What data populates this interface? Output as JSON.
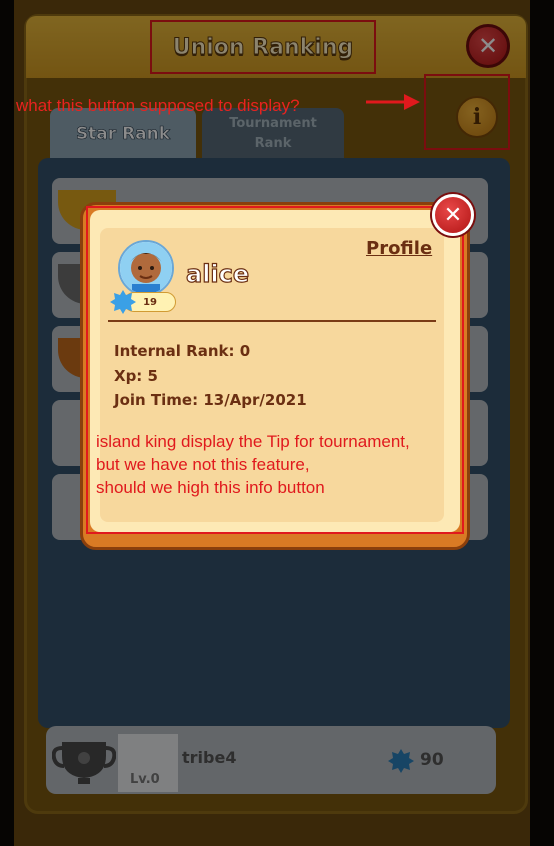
{
  "header": {
    "title": "Union Ranking",
    "close_icon": "close-icon"
  },
  "tabs": [
    {
      "label": "Star Rank",
      "active": true
    },
    {
      "label_line1": "Tournament",
      "label_line2": "Rank",
      "active": false
    }
  ],
  "info_button": {
    "icon": "info-icon",
    "glyph": "i"
  },
  "annotations": {
    "info_question": "what this button supposed to display?",
    "tip_line1": "island king display the Tip for tournament,",
    "tip_line2": "but we have not this feature,",
    "tip_line3": "should we high this info button"
  },
  "profile_popup": {
    "heading": "Profile",
    "username": "alice",
    "level": "19",
    "internal_rank": "Internal Rank: 0",
    "xp": "Xp: 5",
    "join_time": "Join Time: 13/Apr/2021",
    "close_glyph": "✕"
  },
  "bottom_row": {
    "name": "tribe4",
    "level": "Lv.0",
    "score": "90"
  },
  "colors": {
    "annotation_red": "#e0191d",
    "popup_orange": "#d97a24",
    "header_gold": "#d29a22",
    "list_blue": "#34516a"
  }
}
